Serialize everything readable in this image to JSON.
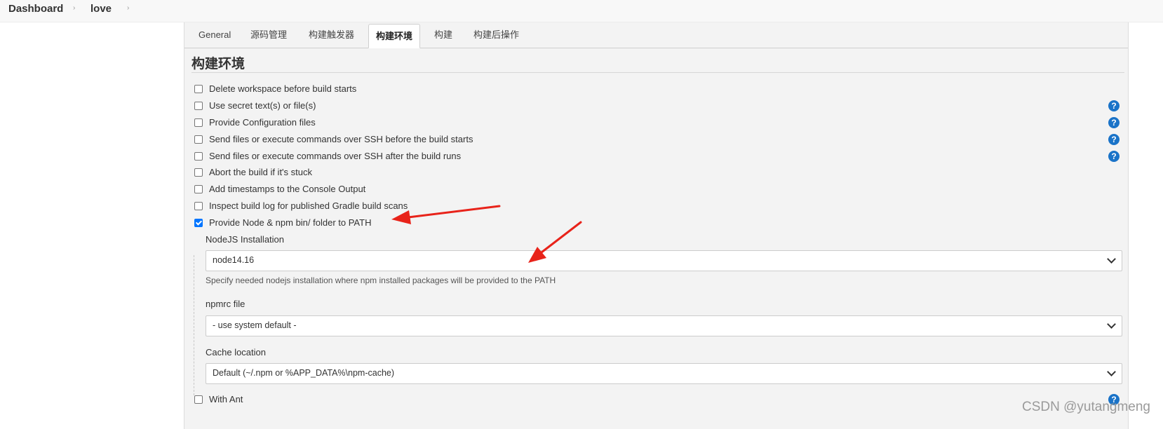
{
  "breadcrumb": {
    "dashboard": "Dashboard",
    "job": "love",
    "separator": "›"
  },
  "tabs": [
    {
      "label": "General"
    },
    {
      "label": "源码管理"
    },
    {
      "label": "构建触发器"
    },
    {
      "label": "构建环境",
      "active": true
    },
    {
      "label": "构建"
    },
    {
      "label": "构建后操作"
    }
  ],
  "section": {
    "title": "构建环境"
  },
  "options": [
    {
      "label": "Delete workspace before build starts",
      "checked": false,
      "help": false
    },
    {
      "label": "Use secret text(s) or file(s)",
      "checked": false,
      "help": true
    },
    {
      "label": "Provide Configuration files",
      "checked": false,
      "help": true
    },
    {
      "label": "Send files or execute commands over SSH before the build starts",
      "checked": false,
      "help": true
    },
    {
      "label": "Send files or execute commands over SSH after the build runs",
      "checked": false,
      "help": true
    },
    {
      "label": "Abort the build if it's stuck",
      "checked": false,
      "help": false
    },
    {
      "label": "Add timestamps to the Console Output",
      "checked": false,
      "help": false
    },
    {
      "label": "Inspect build log for published Gradle build scans",
      "checked": false,
      "help": false
    },
    {
      "label": "Provide Node & npm bin/ folder to PATH",
      "checked": true,
      "help": false
    }
  ],
  "node": {
    "installation_label": "NodeJS Installation",
    "installation_value": "node14.16",
    "installation_desc": "Specify needed nodejs installation where npm installed packages will be provided to the PATH",
    "npmrc_label": "npmrc file",
    "npmrc_value": "- use system default -",
    "cache_label": "Cache location",
    "cache_value": "Default (~/.npm or %APP_DATA%\\npm-cache)"
  },
  "with_ant": {
    "label": "With Ant",
    "checked": false
  },
  "help_glyph": "?",
  "watermark": "CSDN @yutangmeng",
  "colors": {
    "accent": "#0075ff",
    "help": "#1a73c8",
    "annotation_arrow": "#e8231a"
  }
}
